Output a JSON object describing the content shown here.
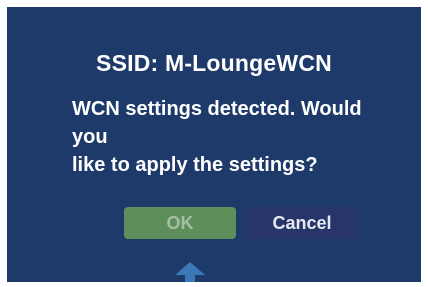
{
  "dialog": {
    "title": "SSID: M-LoungeWCN",
    "message_line1": "WCN settings detected. Would you",
    "message_line2": "like to apply the settings?",
    "ok_label": "OK",
    "cancel_label": "Cancel",
    "focused_button": "OK"
  },
  "icons": {
    "nav_arrow": "up-arrow-icon"
  },
  "colors": {
    "background": "#1d3a6b",
    "ok_button": "#5e8e5a",
    "cancel_button": "#28356a",
    "arrow": "#3a78b6"
  }
}
